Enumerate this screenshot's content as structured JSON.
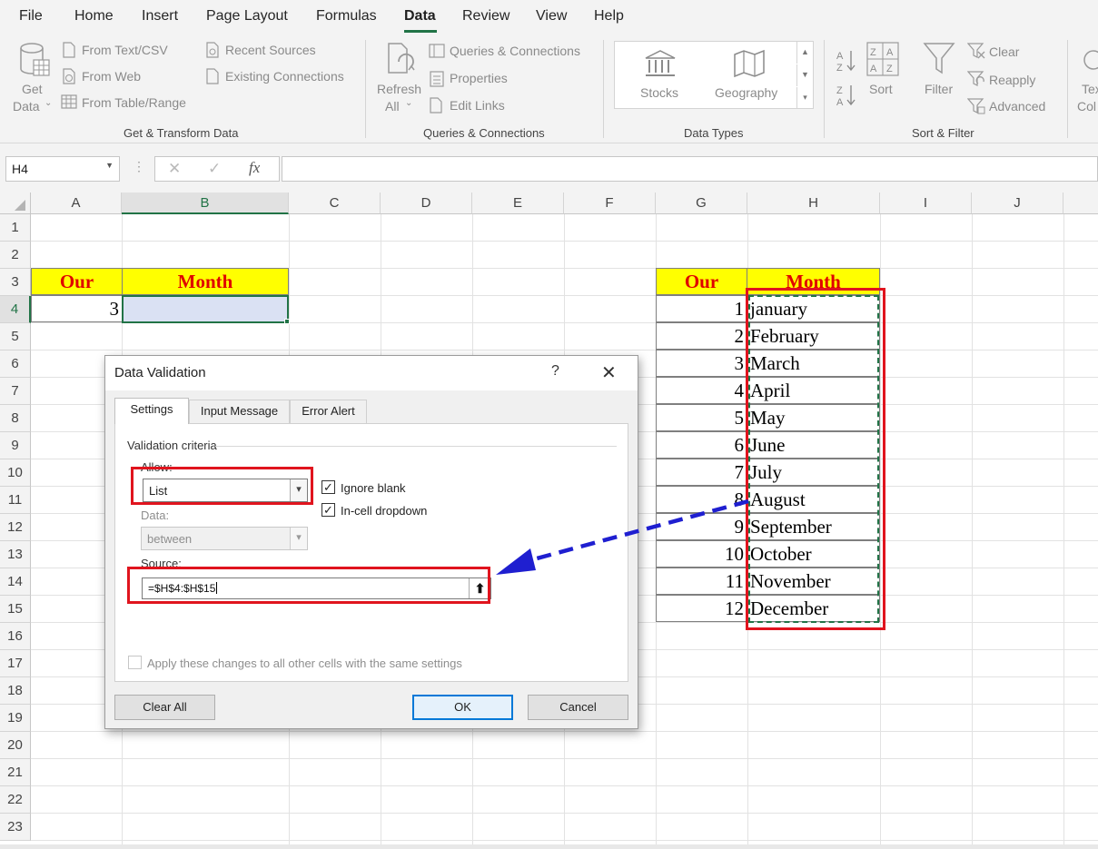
{
  "menu": {
    "items": [
      "File",
      "Home",
      "Insert",
      "Page Layout",
      "Formulas",
      "Data",
      "Review",
      "View",
      "Help"
    ],
    "active": "Data"
  },
  "ribbon": {
    "get_transform": {
      "get_data_line1": "Get",
      "get_data_line2": "Data",
      "from_text_csv": "From Text/CSV",
      "from_web": "From Web",
      "from_table_range": "From Table/Range",
      "recent_sources": "Recent Sources",
      "existing_connections": "Existing Connections",
      "group_label": "Get & Transform Data"
    },
    "queries": {
      "refresh_line1": "Refresh",
      "refresh_line2": "All",
      "queries_connections": "Queries & Connections",
      "properties": "Properties",
      "edit_links": "Edit Links",
      "group_label": "Queries & Connections"
    },
    "data_types": {
      "stocks": "Stocks",
      "geography": "Geography",
      "group_label": "Data Types"
    },
    "sort_filter": {
      "sort": "Sort",
      "filter": "Filter",
      "clear": "Clear",
      "reapply": "Reapply",
      "advanced": "Advanced",
      "group_label": "Sort & Filter"
    },
    "text_columns": {
      "line1": "Tex",
      "line2": "Col"
    }
  },
  "formula_bar": {
    "name_box": "H4",
    "fx": "fx",
    "cancel": "✕",
    "enter": "✓",
    "value": ""
  },
  "grid": {
    "columns": [
      "A",
      "B",
      "C",
      "D",
      "E",
      "F",
      "G",
      "H",
      "I",
      "J"
    ],
    "rows": [
      "1",
      "2",
      "3",
      "4",
      "5",
      "6",
      "7",
      "8",
      "9",
      "10",
      "11",
      "12",
      "13",
      "14",
      "15",
      "16",
      "17",
      "18",
      "19",
      "20",
      "21",
      "22",
      "23"
    ],
    "selected_column": "B",
    "selected_row": "4",
    "left_table": {
      "header_our": "Our",
      "header_month": "Month",
      "our_value": "3",
      "month_value": ""
    },
    "right_table": {
      "header_our": "Our",
      "header_month": "Month",
      "rows": [
        {
          "our": "1",
          "month": "january"
        },
        {
          "our": "2",
          "month": "February"
        },
        {
          "our": "3",
          "month": "March"
        },
        {
          "our": "4",
          "month": "April"
        },
        {
          "our": "5",
          "month": "May"
        },
        {
          "our": "6",
          "month": "June"
        },
        {
          "our": "7",
          "month": "July"
        },
        {
          "our": "8",
          "month": "August"
        },
        {
          "our": "9",
          "month": "September"
        },
        {
          "our": "10",
          "month": "October"
        },
        {
          "our": "11",
          "month": "November"
        },
        {
          "our": "12",
          "month": "December"
        }
      ]
    }
  },
  "dialog": {
    "title": "Data Validation",
    "help": "?",
    "close": "✕",
    "tabs": [
      "Settings",
      "Input Message",
      "Error Alert"
    ],
    "active_tab": "Settings",
    "validation_criteria": "Validation criteria",
    "allow_label": "Allow:",
    "allow_value": "List",
    "ignore_blank": "Ignore blank",
    "ignore_blank_checked": true,
    "in_cell_dropdown": "In-cell dropdown",
    "in_cell_dropdown_checked": true,
    "data_label": "Data:",
    "data_value": "between",
    "source_label": "Source:",
    "source_value": "=$H$4:$H$15",
    "apply_all": "Apply these changes to all other cells with the same settings",
    "apply_all_checked": false,
    "clear_all": "Clear All",
    "ok": "OK",
    "cancel": "Cancel"
  },
  "colors": {
    "excel_green": "#217346",
    "header_fill": "#ffff00",
    "header_text": "#e00000",
    "annotation_red": "#e0141e",
    "annotation_arrow": "#1f1fd0",
    "selection_fill": "#dae1f3"
  },
  "icons": [
    "database-icon",
    "text-file-icon",
    "web-icon",
    "table-icon",
    "recent-icon",
    "connections-icon",
    "refresh-icon",
    "queries-icon",
    "properties-icon",
    "edit-links-icon",
    "stocks-icon",
    "geography-icon",
    "sort-az-icon",
    "sort-za-icon",
    "sort-icon",
    "filter-icon",
    "clear-filter-icon",
    "reapply-icon",
    "advanced-filter-icon",
    "upload-arrow-icon",
    "chevron-down-icon"
  ]
}
